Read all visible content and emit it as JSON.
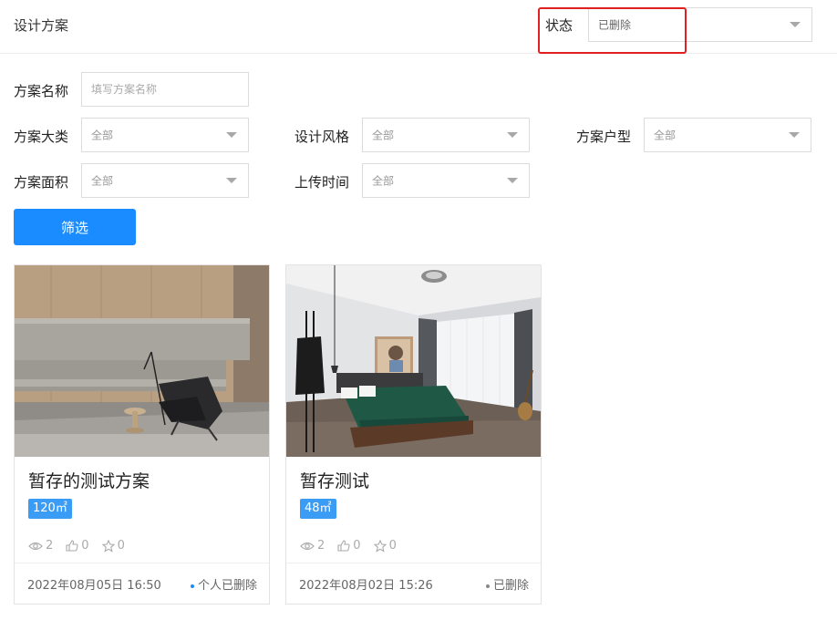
{
  "header": {
    "title": "设计方案",
    "status_label": "状态",
    "status_value": "已删除"
  },
  "filters": {
    "name_label": "方案名称",
    "name_placeholder": "填写方案名称",
    "category_label": "方案大类",
    "category_value": "全部",
    "style_label": "设计风格",
    "style_value": "全部",
    "layout_label": "方案户型",
    "layout_value": "全部",
    "area_label": "方案面积",
    "area_value": "全部",
    "upload_label": "上传时间",
    "upload_value": "全部",
    "filter_button": "筛选"
  },
  "cards": [
    {
      "title": "暂存的测试方案",
      "area": "120㎡",
      "views": "2",
      "likes": "0",
      "favorites": "0",
      "time": "2022年08月05日 16:50",
      "status": "个人已删除",
      "status_dot_color": "#1a8cff"
    },
    {
      "title": "暂存测试",
      "area": "48㎡",
      "views": "2",
      "likes": "0",
      "favorites": "0",
      "time": "2022年08月02日 15:26",
      "status": "已删除",
      "status_dot_color": "#888888"
    }
  ],
  "colors": {
    "primary": "#1a8cff",
    "badge": "#3b9cf5",
    "highlight": "#e02020"
  }
}
